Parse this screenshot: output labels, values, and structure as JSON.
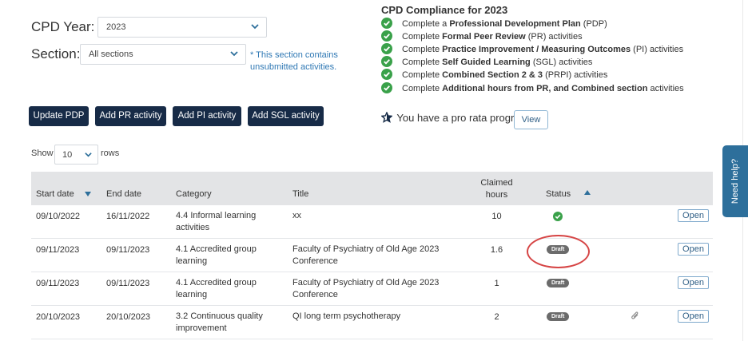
{
  "filters": {
    "year_label": "CPD Year:",
    "year_value": "2023",
    "section_label": "Section:",
    "section_value": "All sections",
    "note_line1": "* This section contains",
    "note_line2": "unsubmitted activities."
  },
  "actions": {
    "update_pdp": "Update PDP",
    "add_pr": "Add PR activity",
    "add_pi": "Add PI activity",
    "add_sgl": "Add SGL activity"
  },
  "compliance": {
    "title": "CPD Compliance for 2023",
    "items": [
      {
        "pre": "Complete a ",
        "bold": "Professional Development Plan",
        "post": " (PDP)"
      },
      {
        "pre": "Complete ",
        "bold": "Formal Peer Review",
        "post": " (PR) activities"
      },
      {
        "pre": "Complete ",
        "bold": "Practice Improvement / Measuring Outcomes",
        "post": " (PI) activities"
      },
      {
        "pre": "Complete ",
        "bold": "Self Guided Learning",
        "post": " (SGL) activities"
      },
      {
        "pre": "Complete ",
        "bold": "Combined Section 2 & 3",
        "post": " (PRPI) activities"
      },
      {
        "pre": "Complete ",
        "bold": "Additional hours from PR, and Combined section",
        "post": " activities"
      }
    ],
    "status_color": "#3aa14a"
  },
  "pro_rata": {
    "text": "You have a pro rata program",
    "view_label": "View"
  },
  "table_controls": {
    "show_label": "Show",
    "rows_value": "10",
    "rows_label": "rows"
  },
  "table": {
    "headers": {
      "start_date": "Start date",
      "end_date": "End date",
      "category": "Category",
      "title": "Title",
      "claimed_line1": "Claimed",
      "claimed_line2": "hours",
      "status": "Status"
    },
    "rows": [
      {
        "start": "09/10/2022",
        "end": "16/11/2022",
        "cat1": "4.4 Informal learning",
        "cat2": "activities",
        "title1": "xx",
        "title2": "",
        "hours": "10",
        "status": "complete-icon",
        "open": "Open"
      },
      {
        "start": "09/11/2023",
        "end": "09/11/2023",
        "cat1": "4.1 Accredited group",
        "cat2": "learning",
        "title1": "Faculty of Psychiatry of Old Age 2023",
        "title2": "Conference",
        "hours": "1.6",
        "status": "Draft",
        "open": "Open"
      },
      {
        "start": "09/11/2023",
        "end": "09/11/2023",
        "cat1": "4.1 Accredited group",
        "cat2": "learning",
        "title1": "Faculty of Psychiatry of Old Age 2023",
        "title2": "Conference",
        "hours": "1",
        "status": "Draft",
        "open": "Open"
      },
      {
        "start": "20/10/2023",
        "end": "20/10/2023",
        "cat1": "3.2 Continuous quality",
        "cat2": "improvement",
        "title1": "QI long term psychotherapy",
        "title2": "",
        "hours": "2",
        "status": "Draft",
        "open": "Open"
      }
    ]
  },
  "help": {
    "label": "Need help?"
  },
  "colors": {
    "primary": "#172b47",
    "link": "#2f78b4",
    "help": "#2d6f9b",
    "highlight": "#d64545"
  }
}
